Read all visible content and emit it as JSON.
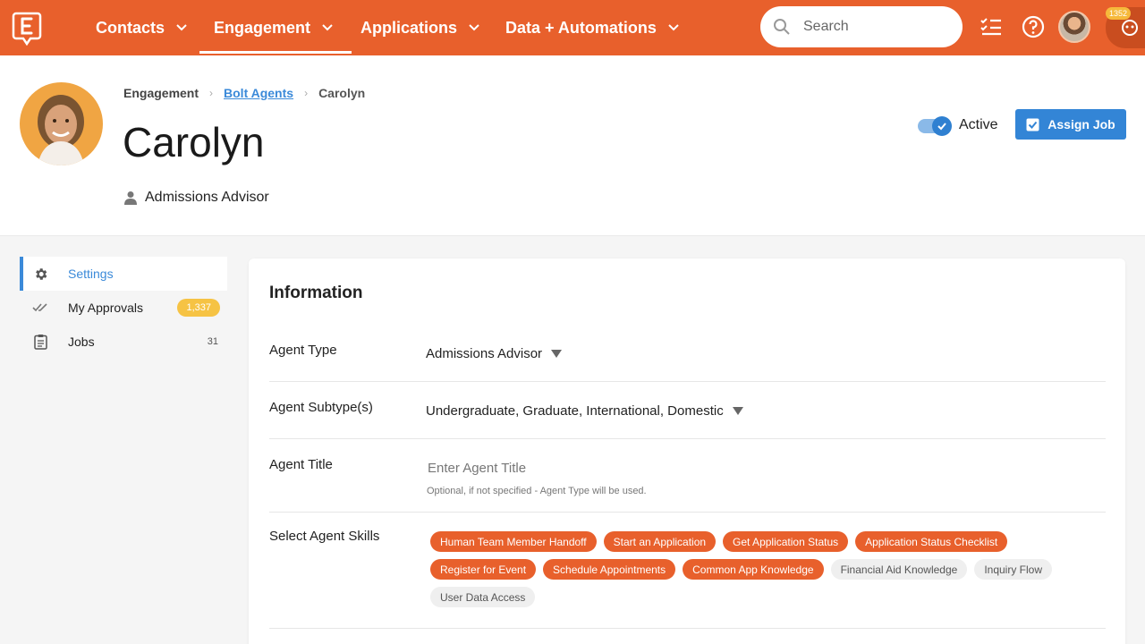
{
  "nav": {
    "items": [
      {
        "label": "Contacts"
      },
      {
        "label": "Engagement"
      },
      {
        "label": "Applications"
      },
      {
        "label": "Data + Automations"
      }
    ],
    "search_placeholder": "Search",
    "notification_count": "1352"
  },
  "breadcrumb": {
    "root": "Engagement",
    "parent": "Bolt Agents",
    "current": "Carolyn"
  },
  "profile": {
    "name": "Carolyn",
    "role": "Admissions Advisor",
    "status_label": "Active",
    "assign_label": "Assign Job"
  },
  "sidebar": {
    "items": [
      {
        "label": "Settings"
      },
      {
        "label": "My Approvals",
        "badge": "1,337"
      },
      {
        "label": "Jobs",
        "count": "31"
      }
    ]
  },
  "information": {
    "title": "Information",
    "agent_type_label": "Agent Type",
    "agent_type_value": "Admissions Advisor",
    "agent_subtype_label": "Agent Subtype(s)",
    "agent_subtype_value": "Undergraduate, Graduate, International, Domestic",
    "agent_title_label": "Agent Title",
    "agent_title_placeholder": "Enter Agent Title",
    "agent_title_hint": "Optional, if not specified - Agent Type will be used.",
    "skills_label": "Select Agent Skills",
    "skills": [
      {
        "label": "Human Team Member Handoff",
        "selected": true
      },
      {
        "label": "Start an Application",
        "selected": true
      },
      {
        "label": "Get Application Status",
        "selected": true
      },
      {
        "label": "Application Status Checklist",
        "selected": true
      },
      {
        "label": "Register for Event",
        "selected": true
      },
      {
        "label": "Schedule Appointments",
        "selected": true
      },
      {
        "label": "Common App Knowledge",
        "selected": true
      },
      {
        "label": "Financial Aid Knowledge",
        "selected": false
      },
      {
        "label": "Inquiry Flow",
        "selected": false
      },
      {
        "label": "User Data Access",
        "selected": false
      }
    ]
  },
  "colors": {
    "brand": "#e8602c",
    "accent": "#3385d6",
    "badge": "#f6c344"
  }
}
